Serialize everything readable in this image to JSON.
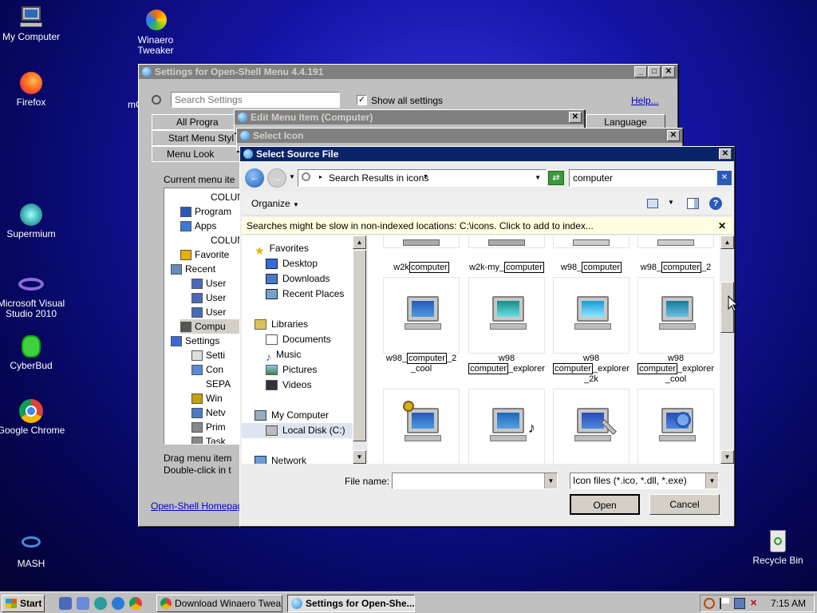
{
  "desktop": {
    "icons": [
      {
        "label": "My Computer",
        "icon": "computer-icon"
      },
      {
        "label": "Winaero Tweaker",
        "icon": "winaero-icon"
      },
      {
        "label": "Firefox",
        "icon": "firefox-icon"
      },
      {
        "label": "Supermium",
        "icon": "supermium-icon"
      },
      {
        "label": "Microsoft Visual Studio 2010",
        "icon": "visual-studio-icon"
      },
      {
        "label": "CyberBud",
        "icon": "cyberbud-icon"
      },
      {
        "label": "Google Chrome",
        "icon": "chrome-icon"
      },
      {
        "label": "MASH",
        "icon": "mash-icon"
      },
      {
        "label": "Recycle Bin",
        "icon": "recycle-bin-icon"
      }
    ],
    "partial_label": "mC"
  },
  "settings_window": {
    "title": "Settings for Open-Shell Menu 4.4.191",
    "search_placeholder": "Search Settings",
    "show_all_label": "Show all settings",
    "show_all_checked": true,
    "help_link": "Help...",
    "tabs": [
      "All Progra",
      "Start Menu Styl",
      "Menu Look",
      "Language"
    ],
    "current_menu_label": "Current menu ite",
    "tree": [
      "COLUM",
      "Program",
      "Apps",
      "COLUM",
      "Favorite",
      "Recent",
      "User",
      "User",
      "User",
      "Compu",
      "Settings",
      "Setti",
      "Con",
      "SEPA",
      "Win",
      "Netv",
      "Prim",
      "Task"
    ],
    "hint1": "Drag menu item",
    "hint2": "Double-click in t",
    "homepage_link": "Open-Shell Homepag"
  },
  "edit_window": {
    "title": "Edit Menu Item (Computer)"
  },
  "select_icon_window": {
    "title": "Select Icon"
  },
  "source_dialog": {
    "title": "Select Source File",
    "breadcrumb": "Search Results in icons",
    "search_value": "computer",
    "organize_label": "Organize",
    "info_bar": "Searches might be slow in non-indexed locations: C:\\icons. Click to add to index...",
    "nav": {
      "favorites": "Favorites",
      "desktop": "Desktop",
      "downloads": "Downloads",
      "recent": "Recent Places",
      "libraries": "Libraries",
      "documents": "Documents",
      "music": "Music",
      "pictures": "Pictures",
      "videos": "Videos",
      "my_computer": "My Computer",
      "local_disk": "Local Disk (C:)",
      "network": "Network"
    },
    "row1": [
      {
        "pre": "w2k",
        "hl": "computer",
        "post": ""
      },
      {
        "pre": "w2k-my_",
        "hl": "computer",
        "post": ""
      },
      {
        "pre": "w98_",
        "hl": "computer",
        "post": ""
      },
      {
        "pre": "w98_",
        "hl": "computer",
        "post": "_2"
      }
    ],
    "row2": [
      {
        "l1pre": "w98_",
        "hl": "computer",
        "l1post": "_2",
        "l2": "_cool",
        "l3": ""
      },
      {
        "l1pre": "w98",
        "hl": "computer",
        "l1post": "_explorer",
        "l2": "",
        "l3": ""
      },
      {
        "l1pre": "w98",
        "hl": "computer",
        "l1post": "_explorer",
        "l2": "_2k",
        "l3": ""
      },
      {
        "l1pre": "w98",
        "hl": "computer",
        "l1post": "_explorer",
        "l2": "_cool",
        "l3": ""
      }
    ],
    "filename_label": "File name:",
    "filename_value": "",
    "filetype_value": "Icon files (*.ico, *.dll, *.exe)",
    "open_label": "Open",
    "cancel_label": "Cancel"
  },
  "taskbar": {
    "start_label": "Start",
    "tasks": [
      "Download Winaero Twea...",
      "Settings for Open-She..."
    ],
    "clock": "7:15 AM"
  }
}
